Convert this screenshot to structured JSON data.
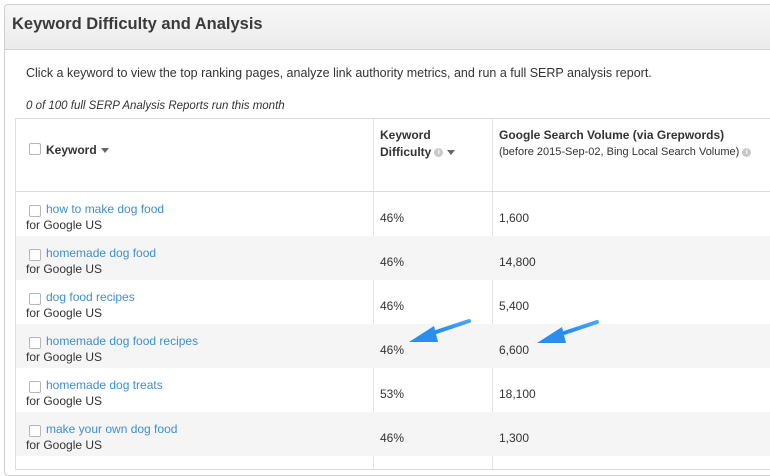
{
  "panel": {
    "title": "Keyword Difficulty and Analysis"
  },
  "intro": "Click a keyword to view the top ranking pages, analyze link authority metrics, and run a full SERP analysis report.",
  "reports_note": "0 of 100 full SERP Analysis Reports run this month",
  "table": {
    "headers": {
      "keyword": "Keyword",
      "difficulty_line1": "Keyword",
      "difficulty_line2": "Difficulty",
      "volume_line1": "Google Search Volume (via Grepwords)",
      "volume_line2": "(before 2015-Sep-02, Bing Local Search Volume)"
    },
    "rows": [
      {
        "keyword": "how to make dog food",
        "engine": "for Google US",
        "difficulty": "46%",
        "volume": "1,600"
      },
      {
        "keyword": "homemade dog food",
        "engine": "for Google US",
        "difficulty": "46%",
        "volume": "14,800"
      },
      {
        "keyword": "dog food recipes",
        "engine": "for Google US",
        "difficulty": "46%",
        "volume": "5,400"
      },
      {
        "keyword": "homemade dog food recipes",
        "engine": "for Google US",
        "difficulty": "46%",
        "volume": "6,600"
      },
      {
        "keyword": "homemade dog treats",
        "engine": "for Google US",
        "difficulty": "53%",
        "volume": "18,100"
      },
      {
        "keyword": "make your own dog food",
        "engine": "for Google US",
        "difficulty": "46%",
        "volume": "1,300"
      }
    ]
  },
  "colors": {
    "link": "#3f8fce",
    "arrow": "#2a8ef0",
    "row_alt": "#f5f5f5"
  },
  "icons": {
    "sort": "chevron-down-icon",
    "info": "info-icon",
    "annotation": "arrow-icon"
  }
}
